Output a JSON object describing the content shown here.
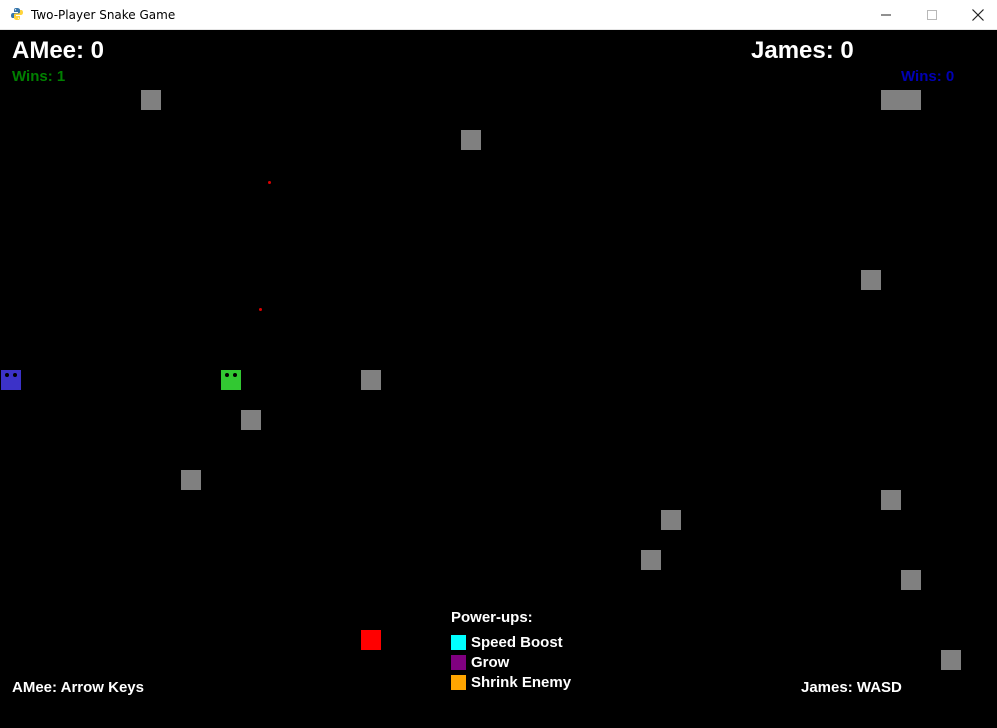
{
  "window": {
    "title": "Two-Player Snake Game",
    "icon": "python-icon",
    "buttons": [
      "minimize-icon",
      "maximize-icon",
      "close-icon"
    ]
  },
  "players": {
    "left": {
      "score_text": "AMee: 0",
      "wins_text": "Wins: 1",
      "controls_text": "AMee: Arrow Keys",
      "color": "#008000",
      "snake_color": "#32c832"
    },
    "right": {
      "score_text": "James: 0",
      "wins_text": "Wins: 0",
      "controls_text": "James: WASD",
      "color": "#0000b4",
      "snake_color": "#3c32c8"
    }
  },
  "legend": {
    "title": "Power-ups:",
    "items": [
      {
        "label": "Speed Boost",
        "color": "#00ffff"
      },
      {
        "label": "Grow",
        "color": "#800080"
      },
      {
        "label": "Shrink Enemy",
        "color": "#ffa500"
      }
    ]
  },
  "colors": {
    "background": "#000000",
    "obstacle": "#808080",
    "food": "#ff0000",
    "text": "#ffffff"
  }
}
